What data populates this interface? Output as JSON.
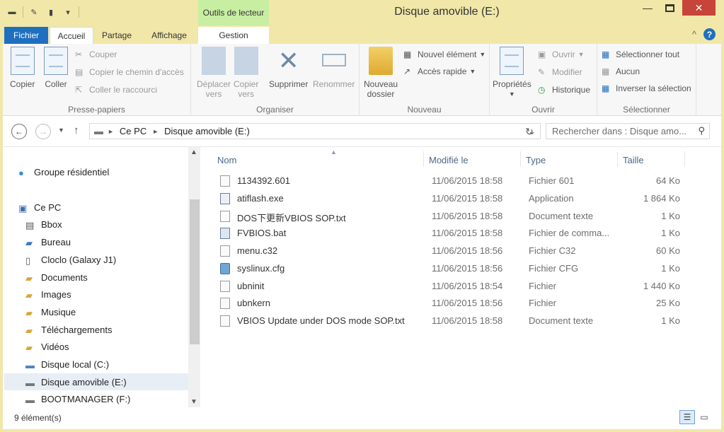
{
  "window": {
    "title": "Disque amovible (E:)",
    "context_tab": "Outils de lecteur",
    "controls": {
      "minimize": "—",
      "close": "✕"
    }
  },
  "ribbon_tabs": [
    "Fichier",
    "Accueil",
    "Partage",
    "Affichage",
    "Gestion"
  ],
  "ribbon": {
    "clipboard": {
      "label": "Presse-papiers",
      "copy": "Copier",
      "paste": "Coller",
      "cut": "Couper",
      "copy_path": "Copier le chemin d'accès",
      "paste_shortcut": "Coller le raccourci"
    },
    "organize": {
      "label": "Organiser",
      "move_to": "Déplacer",
      "move_to_2": "vers",
      "copy_to": "Copier",
      "copy_to_2": "vers",
      "delete": "Supprimer",
      "rename": "Renommer"
    },
    "new": {
      "label": "Nouveau",
      "new_folder": "Nouveau",
      "new_folder_2": "dossier",
      "new_item": "Nouvel élément",
      "easy_access": "Accès rapide"
    },
    "open": {
      "label": "Ouvrir",
      "properties": "Propriétés",
      "open": "Ouvrir",
      "edit": "Modifier",
      "history": "Historique"
    },
    "select": {
      "label": "Sélectionner",
      "select_all": "Sélectionner tout",
      "select_none": "Aucun",
      "invert": "Inverser la sélection"
    }
  },
  "address": {
    "crumbs": [
      "Ce PC",
      "Disque amovible (E:)"
    ],
    "search_placeholder": "Rechercher dans : Disque amo..."
  },
  "nav": {
    "homegroup": "Groupe résidentiel",
    "this_pc": "Ce PC",
    "items": [
      "Bbox",
      "Bureau",
      "Cloclo (Galaxy J1)",
      "Documents",
      "Images",
      "Musique",
      "Téléchargements",
      "Vidéos",
      "Disque local (C:)",
      "Disque amovible (E:)",
      "BOOTMANAGER (F:)"
    ]
  },
  "columns": {
    "name": "Nom",
    "modified": "Modifié le",
    "type": "Type",
    "size": "Taille"
  },
  "files": [
    {
      "name": "1134392.601",
      "date": "11/06/2015 18:58",
      "type": "Fichier 601",
      "size": "64 Ko",
      "icon": "file"
    },
    {
      "name": "atiflash.exe",
      "date": "11/06/2015 18:58",
      "type": "Application",
      "size": "1 864 Ko",
      "icon": "exe"
    },
    {
      "name": "DOS下更新VBIOS SOP.txt",
      "date": "11/06/2015 18:58",
      "type": "Document texte",
      "size": "1 Ko",
      "icon": "file"
    },
    {
      "name": "FVBIOS.bat",
      "date": "11/06/2015 18:58",
      "type": "Fichier de comma...",
      "size": "1 Ko",
      "icon": "bat"
    },
    {
      "name": "menu.c32",
      "date": "11/06/2015 18:56",
      "type": "Fichier C32",
      "size": "60 Ko",
      "icon": "file"
    },
    {
      "name": "syslinux.cfg",
      "date": "11/06/2015 18:56",
      "type": "Fichier CFG",
      "size": "1 Ko",
      "icon": "cfg"
    },
    {
      "name": "ubninit",
      "date": "11/06/2015 18:54",
      "type": "Fichier",
      "size": "1 440 Ko",
      "icon": "file"
    },
    {
      "name": "ubnkern",
      "date": "11/06/2015 18:56",
      "type": "Fichier",
      "size": "25 Ko",
      "icon": "file"
    },
    {
      "name": "VBIOS Update under DOS mode SOP.txt",
      "date": "11/06/2015 18:58",
      "type": "Document texte",
      "size": "1 Ko",
      "icon": "file"
    }
  ],
  "status": {
    "count": "9 élément(s)"
  },
  "colors": {
    "accent": "#1e6fc0",
    "titlebar": "#f1e7a8",
    "context_tab": "#c8eea2",
    "close": "#c7443a"
  }
}
